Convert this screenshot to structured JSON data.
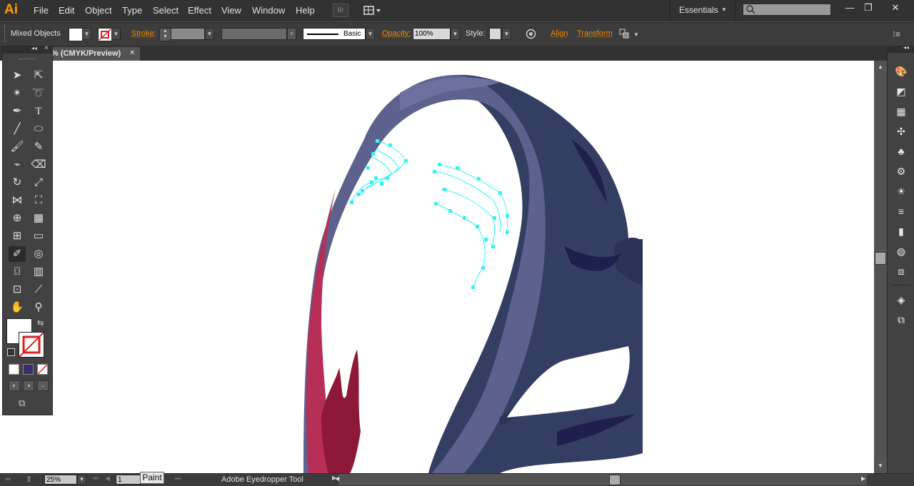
{
  "app": {
    "logo": "Ai"
  },
  "menu": [
    "File",
    "Edit",
    "Object",
    "Type",
    "Select",
    "Effect",
    "View",
    "Window",
    "Help"
  ],
  "workspace": {
    "label": "Essentials"
  },
  "window_buttons": [
    "minimize-icon",
    "restore-icon",
    "close-icon"
  ],
  "control": {
    "selection": "Mixed Objects",
    "stroke_label": "Stroke:",
    "brush": "Basic",
    "opacity_label": "Opacity:",
    "opacity_value": "100%",
    "style_label": "Style:",
    "align_label": "Align",
    "transform_label": "Transform"
  },
  "document": {
    "tab_title": "% (CMYK/Preview)"
  },
  "status": {
    "zoom": "25%",
    "page": "1",
    "tooltip": "Paint",
    "tool_name": "Adobe Eyedropper Tool"
  },
  "colors": {
    "accent": "#f08c00",
    "selection": "#2ff5f5",
    "hood_dark": "#343e63",
    "hood_light": "#5c618d",
    "crimson": "#b52f56"
  }
}
